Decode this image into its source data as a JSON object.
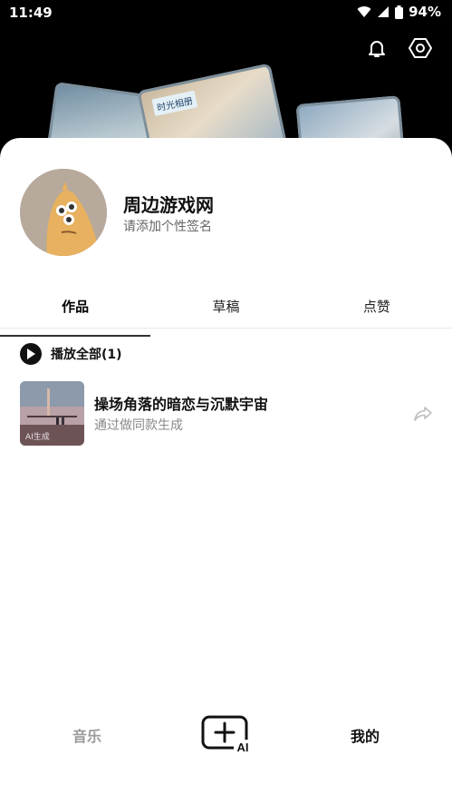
{
  "status_bar": {
    "time": "11:49",
    "battery": "94%",
    "icons": [
      "wifi-icon",
      "cellular-signal-icon",
      "battery-icon"
    ]
  },
  "header": {
    "actions": [
      "bell-icon",
      "settings-hexagon-icon"
    ],
    "card_tag": "时光相册"
  },
  "profile": {
    "name": "周边游戏网",
    "signature_placeholder": "请添加个性签名"
  },
  "tabs": [
    {
      "label": "作品",
      "active": true
    },
    {
      "label": "草稿",
      "active": false
    },
    {
      "label": "点赞",
      "active": false
    }
  ],
  "play_all": {
    "label": "播放全部(1)"
  },
  "songs": [
    {
      "title": "操场角落的暗恋与沉默宇宙",
      "subtitle": "通过做同款生成",
      "cover_badge": "AI生成"
    }
  ],
  "bottom_nav": {
    "music": "音乐",
    "create_icon": "ai-create-icon",
    "create_badge": "AI",
    "mine": "我的"
  }
}
